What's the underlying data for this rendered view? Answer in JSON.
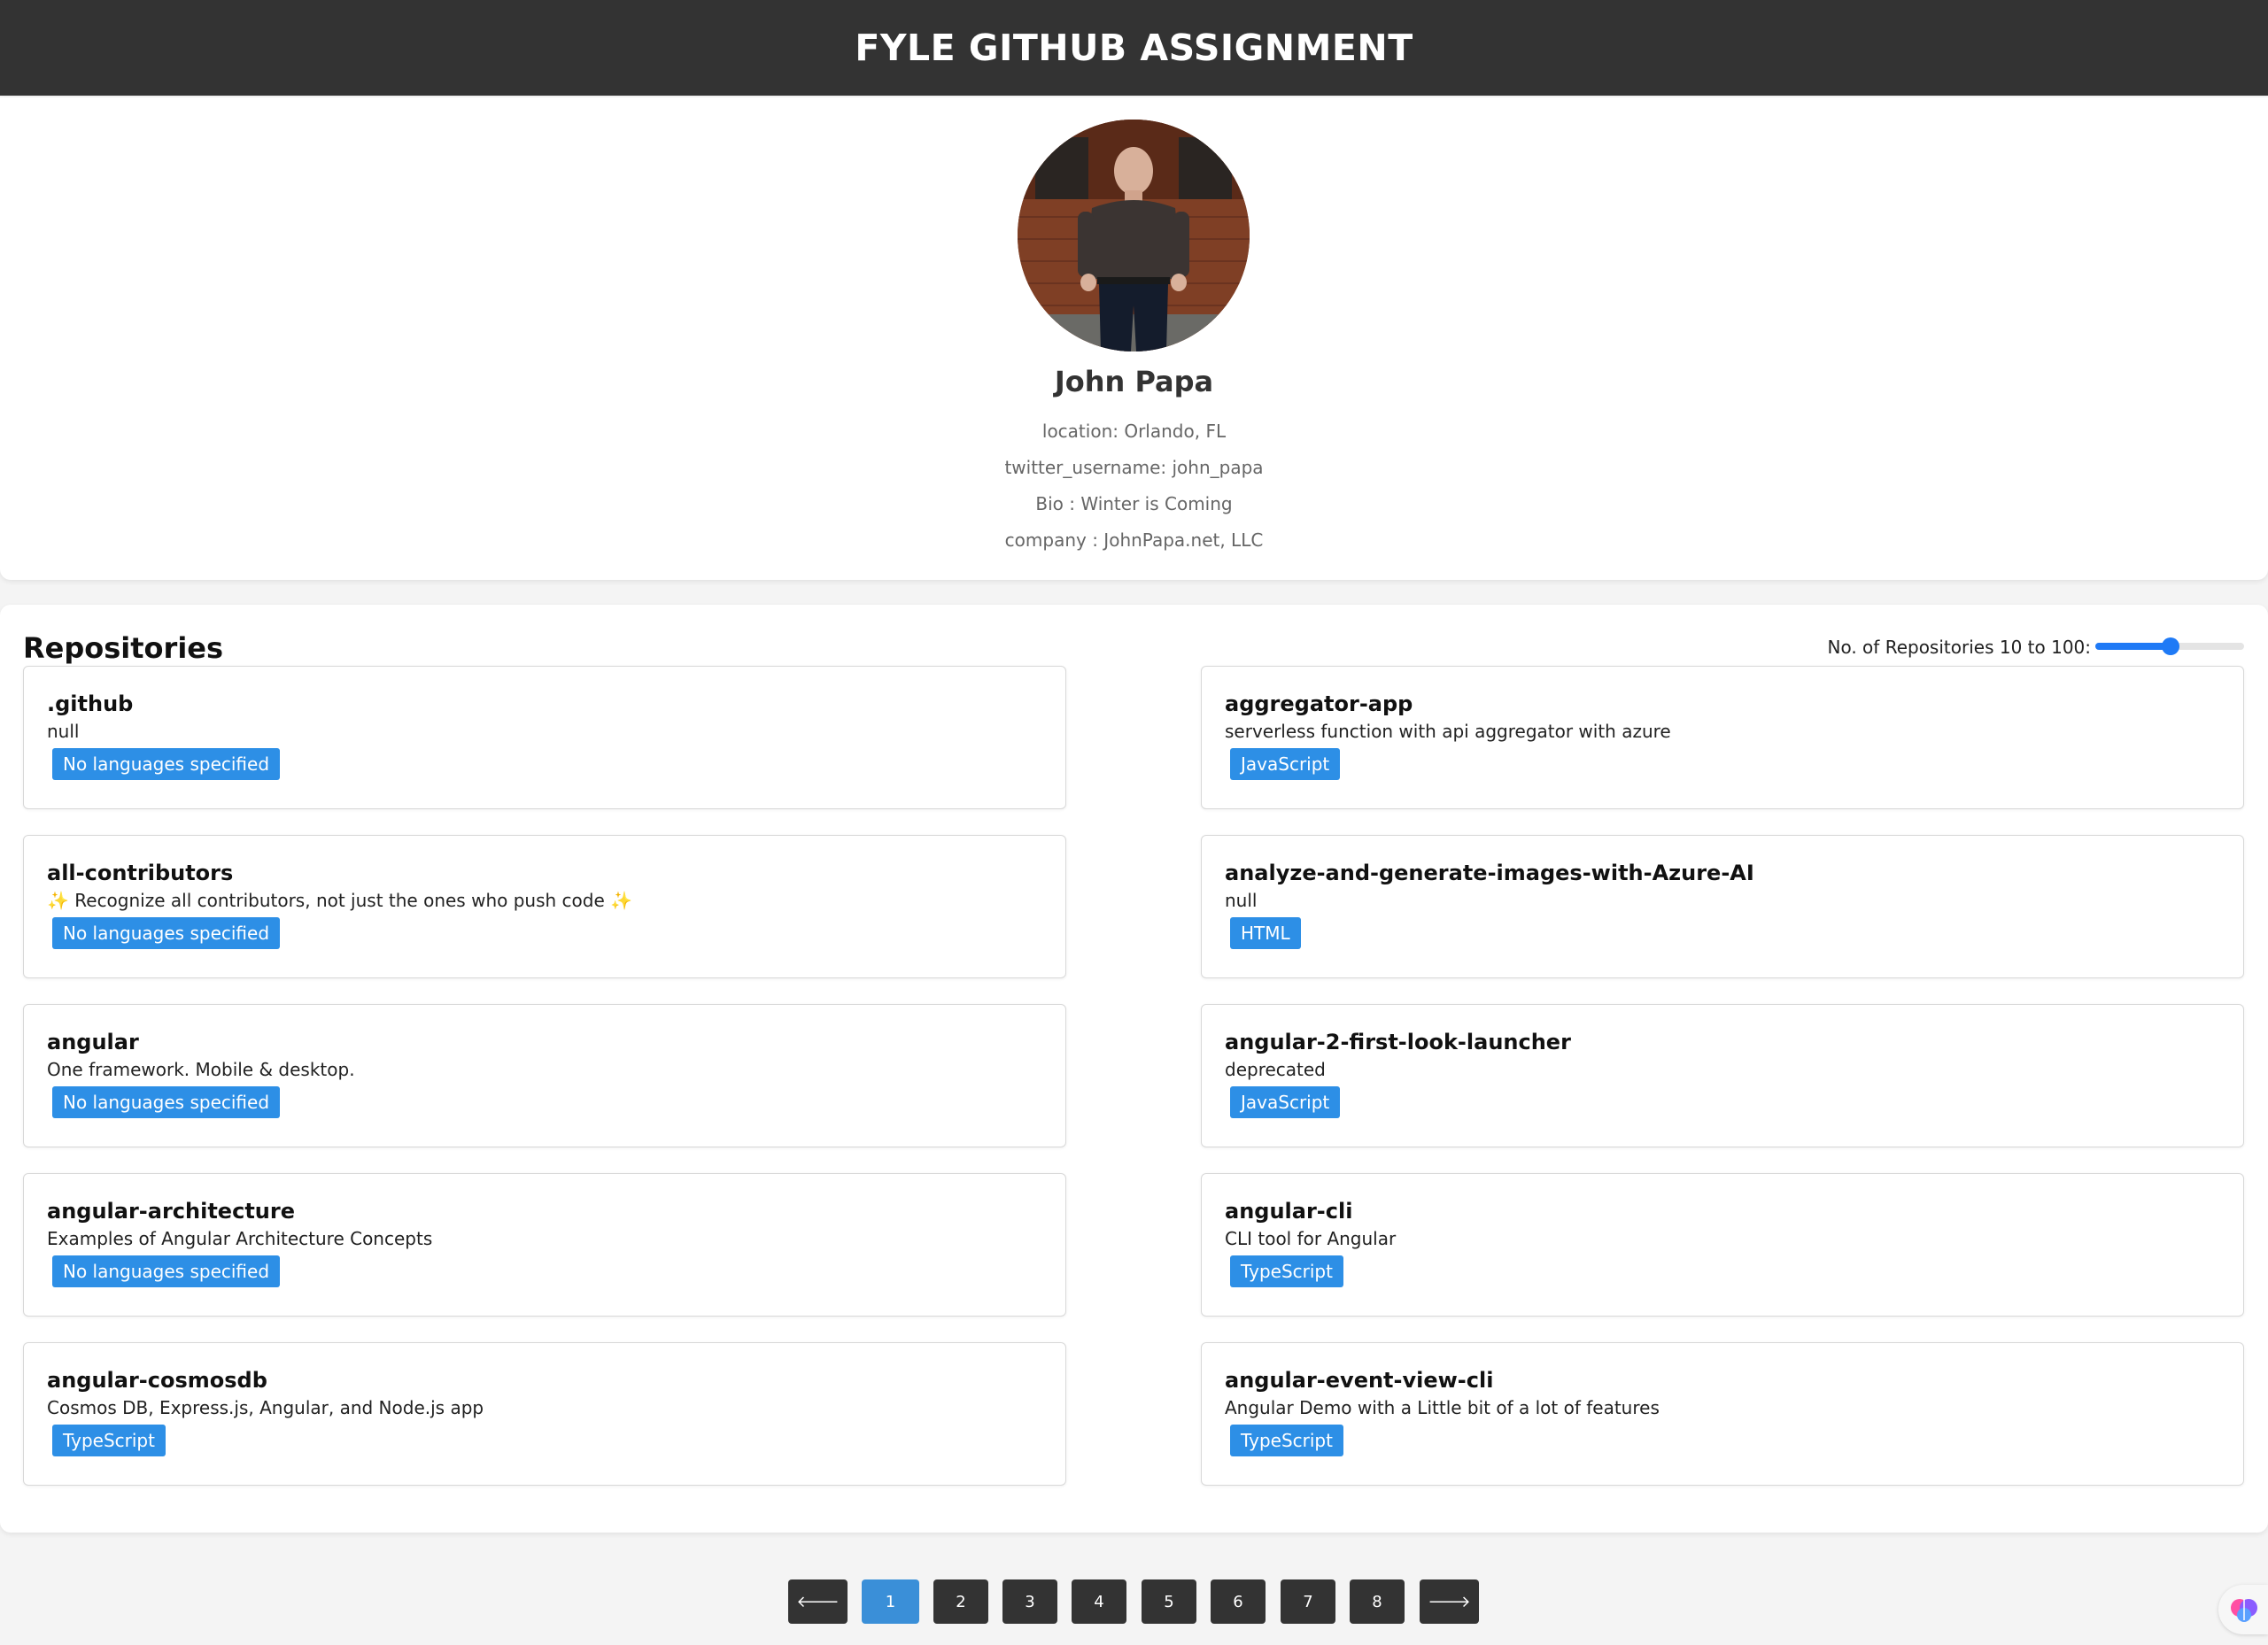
{
  "header": {
    "title": "FYLE GITHUB ASSIGNMENT"
  },
  "profile": {
    "name": "John Papa",
    "location": "location: Orlando, FL",
    "twitter": "twitter_username: john_papa",
    "bio": "Bio : Winter is Coming",
    "company": "company : JohnPapa.net, LLC"
  },
  "repositories": {
    "title": "Repositories",
    "slider_label": "No. of Repositories 10 to 100:",
    "slider_value_fraction": 0.5,
    "items": [
      {
        "name": ".github",
        "description": "null",
        "language": "No languages specified"
      },
      {
        "name": "aggregator-app",
        "description": "serverless function with api aggregator with azure",
        "language": "JavaScript"
      },
      {
        "name": "all-contributors",
        "description": "✨ Recognize all contributors, not just the ones who push code ✨",
        "language": "No languages specified"
      },
      {
        "name": "analyze-and-generate-images-with-Azure-AI",
        "description": "null",
        "language": "HTML"
      },
      {
        "name": "angular",
        "description": "One framework. Mobile & desktop.",
        "language": "No languages specified"
      },
      {
        "name": "angular-2-first-look-launcher",
        "description": "deprecated",
        "language": "JavaScript"
      },
      {
        "name": "angular-architecture",
        "description": "Examples of Angular Architecture Concepts",
        "language": "No languages specified"
      },
      {
        "name": "angular-cli",
        "description": "CLI tool for Angular",
        "language": "TypeScript"
      },
      {
        "name": "angular-cosmosdb",
        "description": "Cosmos DB, Express.js, Angular, and Node.js app",
        "language": "TypeScript"
      },
      {
        "name": "angular-event-view-cli",
        "description": "Angular Demo with a Little bit of a lot of features",
        "language": "TypeScript"
      }
    ]
  },
  "pagination": {
    "prev_label": "🡐",
    "next_label": "🡒",
    "pages": [
      "1",
      "2",
      "3",
      "4",
      "5",
      "6",
      "7",
      "8"
    ],
    "current_page": "1"
  },
  "colors": {
    "header_bg": "#333333",
    "badge_bg": "#2d8fe6",
    "active_page": "#3a8fd8",
    "slider_accent": "#1f7af6"
  },
  "icons": {
    "prev": "arrow-left-icon",
    "next": "arrow-right-icon",
    "widget": "brain-icon"
  }
}
